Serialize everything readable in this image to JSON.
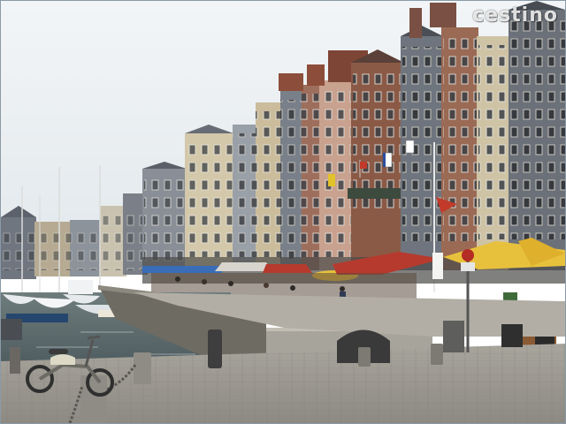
{
  "image": {
    "watermark": "cestino"
  },
  "palette": {
    "sky": "#e9eef1",
    "water": "#5d6e72",
    "cobblestone": "#9a9892",
    "slate_facade": "#7f858d",
    "brick_facade": "#8b5a46",
    "cream_facade": "#cdbf9e",
    "awning_red": "#b63a2e",
    "umbrella_yellow": "#e8c13c",
    "awning_blue": "#3a6db8"
  }
}
